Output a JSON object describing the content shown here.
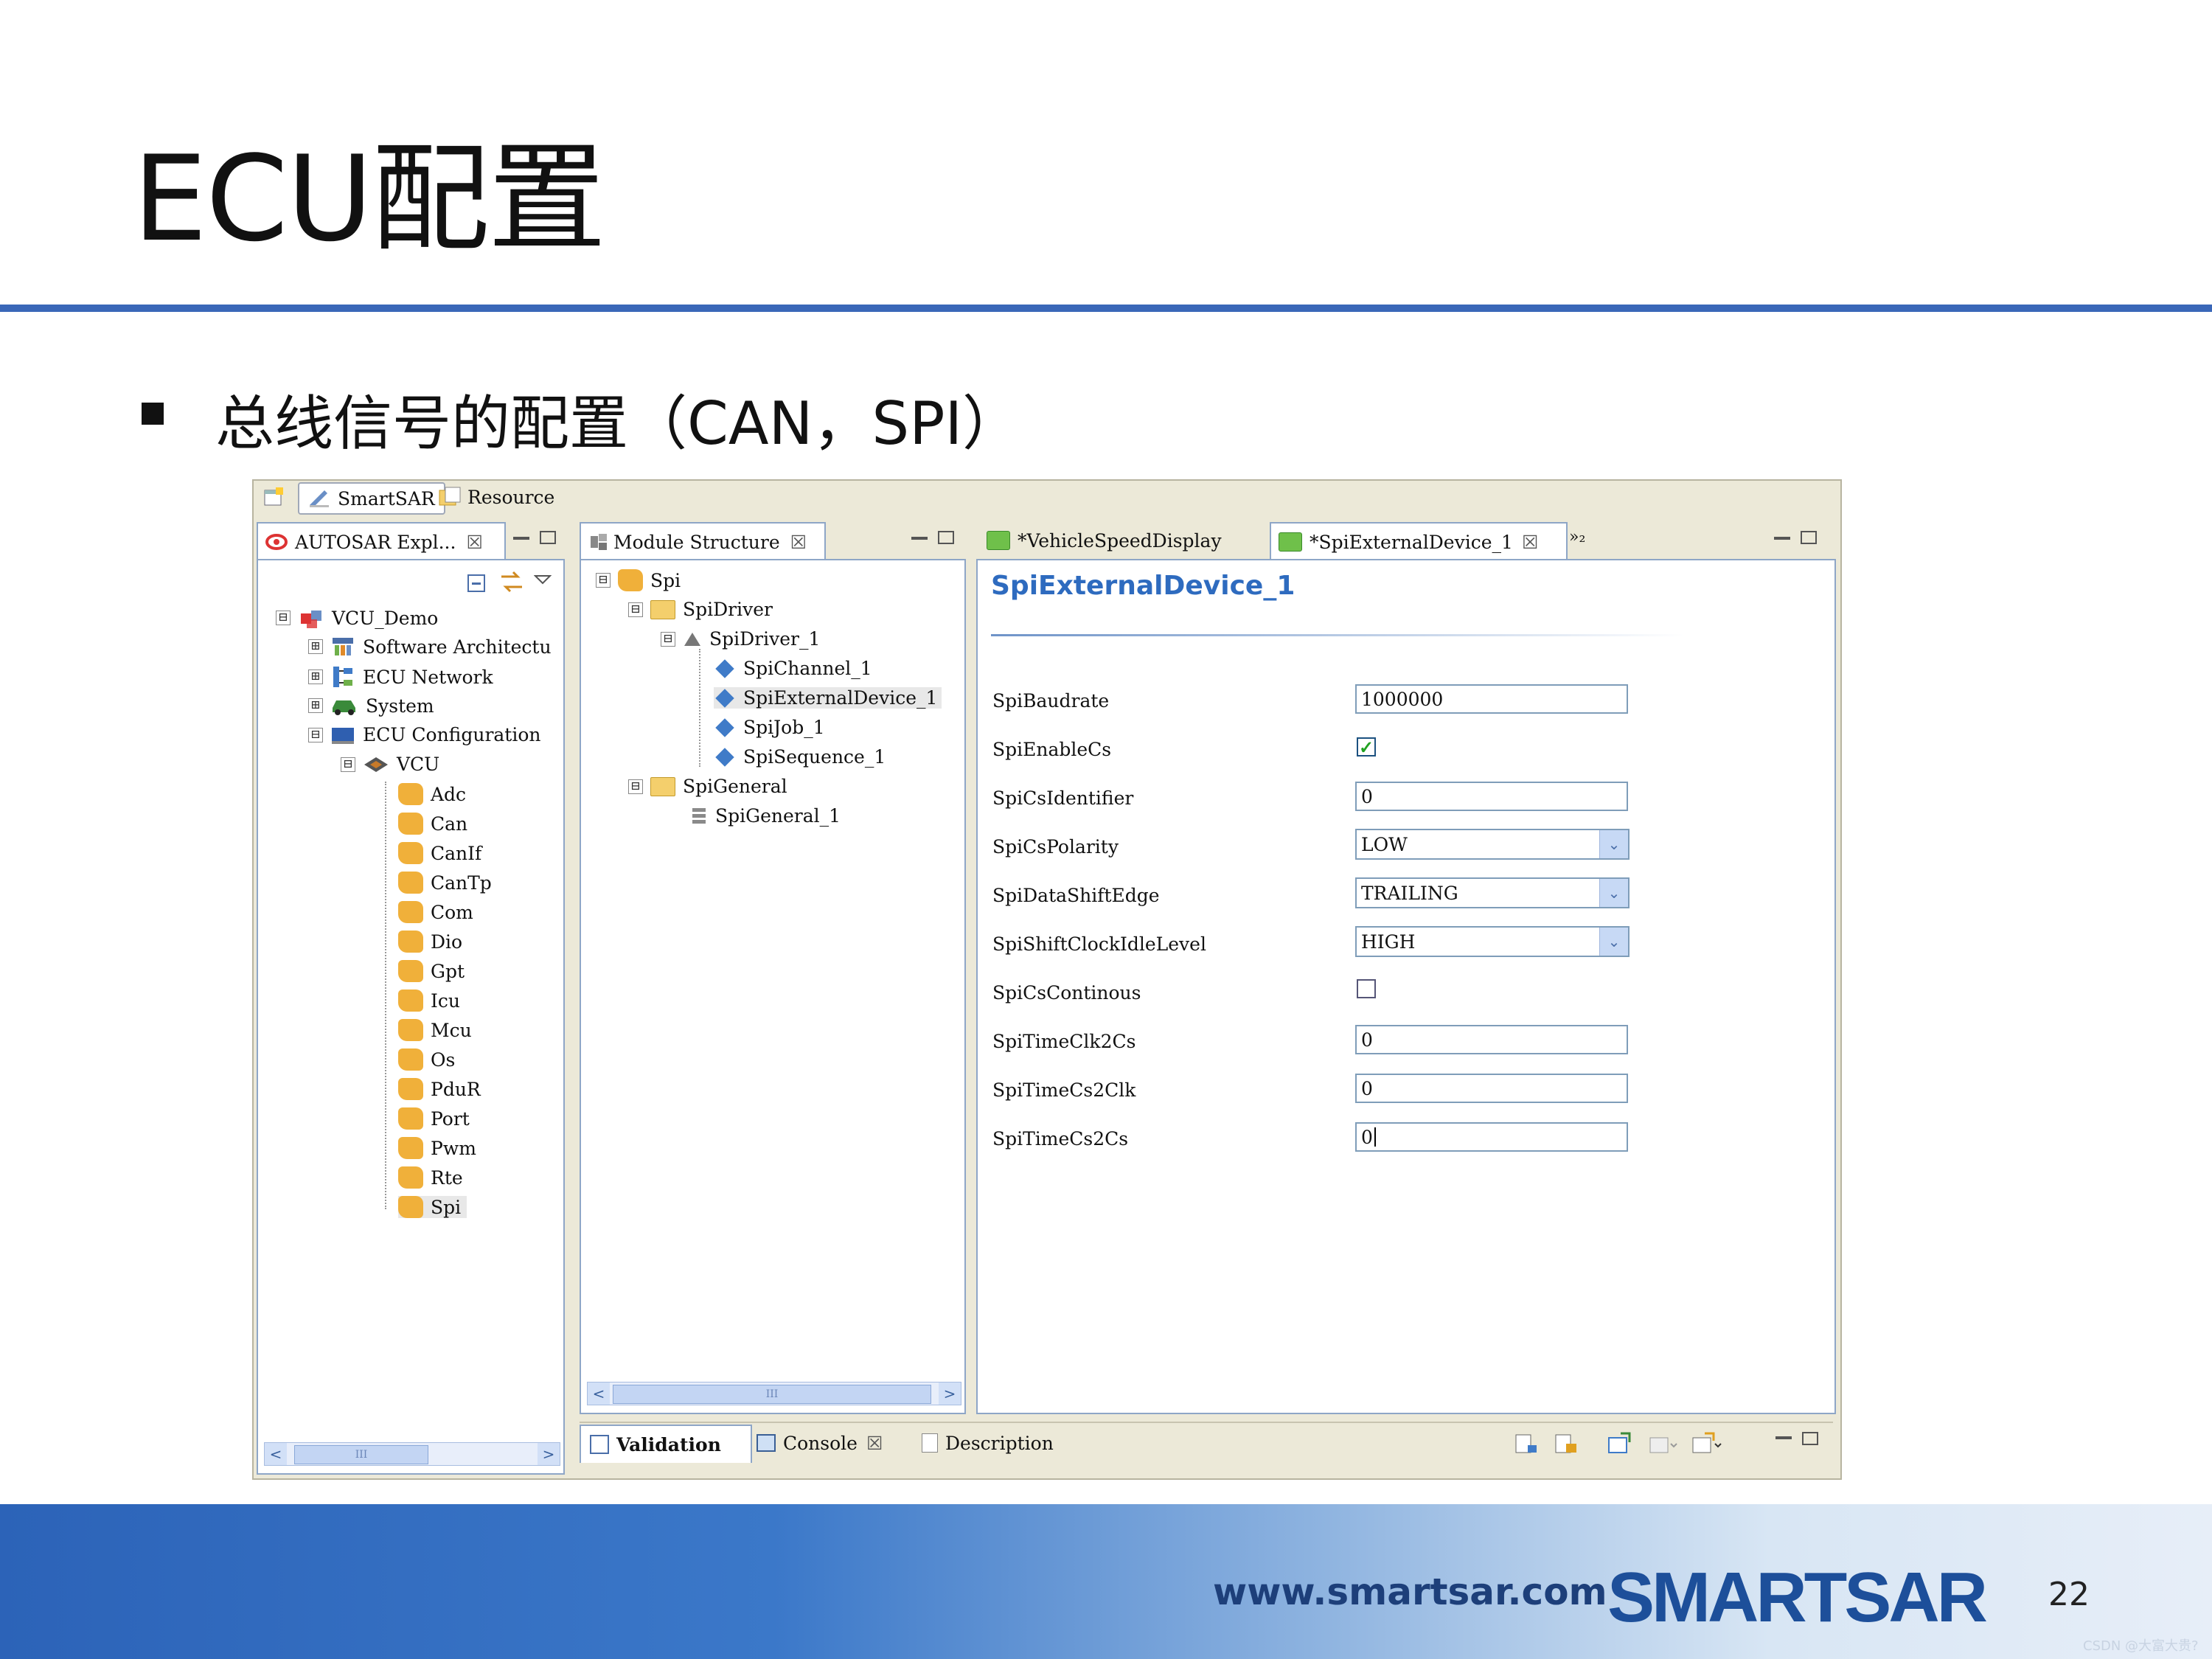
{
  "slide": {
    "title": "ECU配置",
    "bullet": "总线信号的配置（CAN，SPI）",
    "footer_url": "www.smartsar.com",
    "logo_text": "SMARTSAR",
    "page_number": "22",
    "watermark": "CSDN @大富大贵?"
  },
  "colors": {
    "accent": "#3a67b8",
    "footer": "#2c63b8",
    "form_title": "#2e6bbf",
    "tree_selected": "#e8e8e8"
  },
  "perspective_tabs": [
    {
      "label": "SmartSAR",
      "icon": "smartsar-perspective-icon"
    },
    {
      "label": "Resource",
      "icon": "resource-perspective-icon"
    }
  ],
  "explorer": {
    "tab_label": "AUTOSAR Expl...",
    "tree": [
      {
        "label": "VCU_Demo",
        "level": 0,
        "expander": "⊟",
        "icon": "project-icon"
      },
      {
        "label": "Software Architectu",
        "level": 1,
        "expander": "⊞",
        "icon": "architecture-icon"
      },
      {
        "label": "ECU Network",
        "level": 1,
        "expander": "⊞",
        "icon": "network-icon"
      },
      {
        "label": "System",
        "level": 1,
        "expander": "⊞",
        "icon": "car-icon"
      },
      {
        "label": "ECU Configuration",
        "level": 1,
        "expander": "⊟",
        "icon": "ecu-config-icon"
      },
      {
        "label": "VCU",
        "level": 2,
        "expander": "⊟",
        "icon": "vcu-icon"
      },
      {
        "label": "Adc",
        "level": 3,
        "icon": "module-icon"
      },
      {
        "label": "Can",
        "level": 3,
        "icon": "module-icon"
      },
      {
        "label": "CanIf",
        "level": 3,
        "icon": "module-icon"
      },
      {
        "label": "CanTp",
        "level": 3,
        "icon": "module-icon"
      },
      {
        "label": "Com",
        "level": 3,
        "icon": "module-icon"
      },
      {
        "label": "Dio",
        "level": 3,
        "icon": "module-icon"
      },
      {
        "label": "Gpt",
        "level": 3,
        "icon": "module-icon"
      },
      {
        "label": "Icu",
        "level": 3,
        "icon": "module-icon"
      },
      {
        "label": "Mcu",
        "level": 3,
        "icon": "module-icon"
      },
      {
        "label": "Os",
        "level": 3,
        "icon": "module-icon"
      },
      {
        "label": "PduR",
        "level": 3,
        "icon": "module-icon"
      },
      {
        "label": "Port",
        "level": 3,
        "icon": "module-icon"
      },
      {
        "label": "Pwm",
        "level": 3,
        "icon": "module-icon"
      },
      {
        "label": "Rte",
        "level": 3,
        "icon": "module-icon"
      },
      {
        "label": "Spi",
        "level": 3,
        "icon": "module-icon",
        "selected": true
      }
    ]
  },
  "module_structure": {
    "tab_label": "Module Structure",
    "tree": [
      {
        "label": "Spi",
        "level": 0,
        "expander": "⊟",
        "icon": "module-icon"
      },
      {
        "label": "SpiDriver",
        "level": 1,
        "expander": "⊟",
        "icon": "folder-icon"
      },
      {
        "label": "SpiDriver_1",
        "level": 2,
        "expander": "⊟",
        "icon": "triangle-icon"
      },
      {
        "label": "SpiChannel_1",
        "level": 3,
        "icon": "diamond-icon"
      },
      {
        "label": "SpiExternalDevice_1",
        "level": 3,
        "icon": "diamond-icon",
        "selected": true
      },
      {
        "label": "SpiJob_1",
        "level": 3,
        "icon": "diamond-icon"
      },
      {
        "label": "SpiSequence_1",
        "level": 3,
        "icon": "diamond-icon"
      },
      {
        "label": "SpiGeneral",
        "level": 1,
        "expander": "⊟",
        "icon": "folder-icon"
      },
      {
        "label": "SpiGeneral_1",
        "level": 2,
        "icon": "list-icon"
      }
    ]
  },
  "editor": {
    "tabs": [
      {
        "label": "*VehicleSpeedDisplay",
        "active": false
      },
      {
        "label": "*SpiExternalDevice_1",
        "active": true
      }
    ],
    "overflow_label": "»₂",
    "form_title": "SpiExternalDevice_1",
    "fields": [
      {
        "label": "SpiBaudrate",
        "type": "text",
        "value": "1000000"
      },
      {
        "label": "SpiEnableCs",
        "type": "checkbox",
        "checked": true
      },
      {
        "label": "SpiCsIdentifier",
        "type": "text",
        "value": "0"
      },
      {
        "label": "SpiCsPolarity",
        "type": "select",
        "value": "LOW"
      },
      {
        "label": "SpiDataShiftEdge",
        "type": "select",
        "value": "TRAILING"
      },
      {
        "label": "SpiShiftClockIdleLevel",
        "type": "select",
        "value": "HIGH"
      },
      {
        "label": "SpiCsContinous",
        "type": "checkbox",
        "checked": false
      },
      {
        "label": "SpiTimeClk2Cs",
        "type": "text",
        "value": "0"
      },
      {
        "label": "SpiTimeCs2Clk",
        "type": "text",
        "value": "0"
      },
      {
        "label": "SpiTimeCs2Cs",
        "type": "text",
        "value": "0"
      }
    ]
  },
  "bottom_tabs": [
    {
      "label": "Validation",
      "bold": true
    },
    {
      "label": "Console",
      "bold": false
    },
    {
      "label": "Description",
      "bold": false
    }
  ],
  "labels": {
    "close_glyph": "☒",
    "scroll_left": "<",
    "scroll_right": ">",
    "scroll_thumb": "III",
    "dropdown_arrow": "⌄",
    "check_mark": "✓"
  }
}
